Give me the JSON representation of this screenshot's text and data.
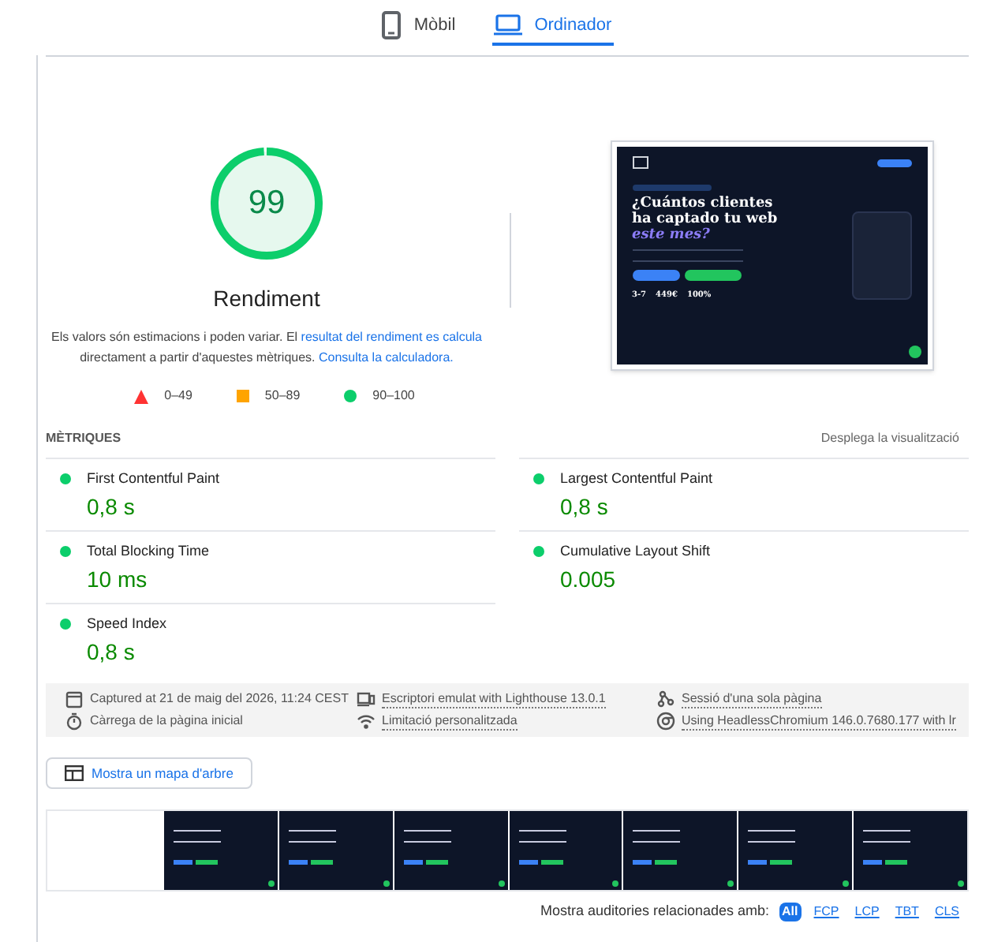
{
  "tabs": [
    {
      "label": "Mòbil",
      "kind": "phone",
      "selected": false
    },
    {
      "label": "Ordinador",
      "kind": "laptop",
      "selected": true
    }
  ],
  "gauge": {
    "score": "99",
    "level": 0.99,
    "title": "Rendiment"
  },
  "note": [
    {
      "kind": "text",
      "text": "Els valors són estimacions i poden variar. El "
    },
    {
      "kind": "link",
      "text": "resultat del rendiment es calcula"
    },
    {
      "kind": "text",
      "text": " directament a partir d'aquestes mètriques. "
    },
    {
      "kind": "link",
      "text": "Consulta la calculadora."
    }
  ],
  "legend": [
    {
      "kind": "triangle",
      "range": "0–49",
      "color": "#ff3333"
    },
    {
      "kind": "square",
      "range": "50–89",
      "color": "#ffa400"
    },
    {
      "kind": "circle",
      "range": "90–100",
      "color": "#0cce6b"
    }
  ],
  "preview": {
    "headline": "¿Cuántos clientes ha captado tu web",
    "accent": "este mes?",
    "stats": [
      "3-7",
      "449€",
      "100%"
    ]
  },
  "metrics": {
    "heading": "MÈTRIQUES",
    "toggle": "Desplega la visualització",
    "items": [
      {
        "name": "First Contentful Paint",
        "value": "0,8 s",
        "color": "#0cce6b"
      },
      {
        "name": "Largest Contentful Paint",
        "value": "0,8 s",
        "color": "#0cce6b"
      },
      {
        "name": "Total Blocking Time",
        "value": "10 ms",
        "color": "#0cce6b"
      },
      {
        "name": "Cumulative Layout Shift",
        "value": "0.005",
        "color": "#0cce6b"
      },
      {
        "name": "Speed Index",
        "value": "0,8 s",
        "color": "#0cce6b"
      }
    ]
  },
  "runtime": [
    {
      "kind": "calendar",
      "text": "Captured at 21 de maig del 2026, 11:24 CEST",
      "link": false
    },
    {
      "kind": "device",
      "text": "Escriptori emulat with Lighthouse 13.0.1",
      "link": true
    },
    {
      "kind": "session",
      "text": "Sessió d'una sola pàgina",
      "link": true
    },
    {
      "kind": "timer",
      "text": "Càrrega de la pàgina inicial",
      "link": false
    },
    {
      "kind": "wifi",
      "text": "Limitació personalitzada",
      "link": true
    },
    {
      "kind": "browser",
      "text": "Using HeadlessChromium 146.0.7680.177 with lr",
      "link": true
    }
  ],
  "treemap_button": "Mostra un mapa d'arbre",
  "filmstrip": [
    {
      "kind": "blank"
    },
    {
      "kind": "shot"
    },
    {
      "kind": "shot"
    },
    {
      "kind": "shot"
    },
    {
      "kind": "shot"
    },
    {
      "kind": "shot"
    },
    {
      "kind": "shot"
    },
    {
      "kind": "shot"
    }
  ],
  "filter": {
    "label": "Mostra auditories relacionades amb:",
    "chips": [
      {
        "label": "All",
        "selected": true
      },
      {
        "label": "FCP",
        "selected": false
      },
      {
        "label": "LCP",
        "selected": false
      },
      {
        "label": "TBT",
        "selected": false
      },
      {
        "label": "CLS",
        "selected": false
      }
    ]
  }
}
